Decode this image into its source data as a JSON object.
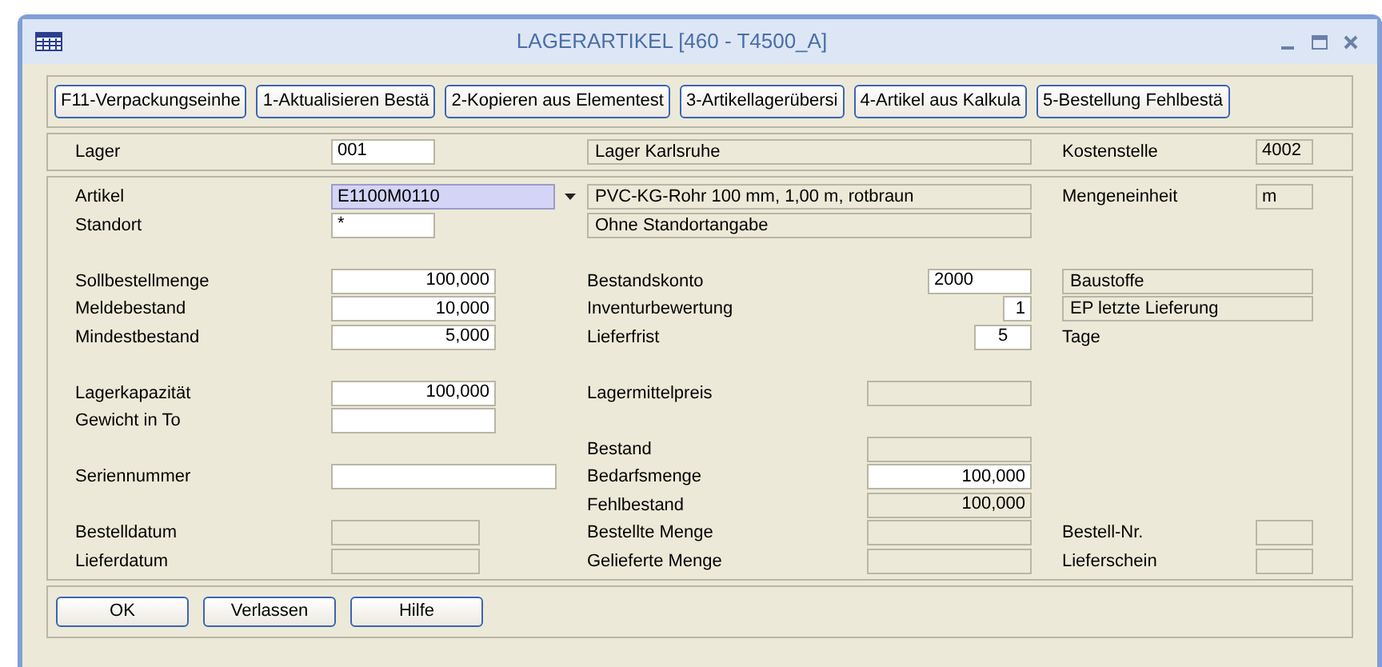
{
  "window": {
    "title": "LAGERARTIKEL  [460 - T4500_A]"
  },
  "toolbar": [
    "F11-Verpackungseinhe",
    "1-Aktualisieren Bestä",
    "2-Kopieren aus Elementest",
    "3-Artikellagerübersi",
    "4-Artikel aus Kalkula",
    "5-Bestellung Fehlbestä"
  ],
  "header_row": {
    "left": {
      "label": "Lager",
      "field": {
        "value": "001",
        "readonly": false,
        "kind": "code"
      }
    },
    "middle": {
      "box": "Lager Karlsruhe"
    },
    "right": {
      "label": "Kostenstelle",
      "field": {
        "value": "4002",
        "readonly": true,
        "kind": "unit"
      }
    }
  },
  "groups": [
    [
      {
        "left": {
          "label": "Artikel",
          "field": {
            "value": "E1100M0110",
            "readonly": false,
            "kind": "combo",
            "focused": true
          }
        },
        "middle": {
          "box": "PVC-KG-Rohr 100 mm, 1,00 m, rotbraun"
        },
        "right": {
          "label": "Mengeneinheit",
          "field": {
            "value": "m",
            "readonly": true,
            "kind": "unit"
          }
        }
      },
      {
        "left": {
          "label": "Standort",
          "field": {
            "value": "*",
            "readonly": false,
            "kind": "code"
          }
        },
        "middle": {
          "box": "Ohne Standortangabe"
        }
      }
    ],
    [
      {
        "left": {
          "label": "Sollbestellmenge",
          "field": {
            "value": "100,000",
            "readonly": false,
            "kind": "quantity"
          }
        },
        "middle": {
          "label": "Bestandskonto",
          "field": {
            "value": "2000",
            "readonly": false,
            "kind": "code"
          }
        },
        "right": {
          "box": "Baustoffe"
        }
      },
      {
        "left": {
          "label": "Meldebestand",
          "field": {
            "value": "10,000",
            "readonly": false,
            "kind": "quantity"
          }
        },
        "middle": {
          "label": "Inventurbewertung",
          "field": {
            "value": "1",
            "readonly": false,
            "kind": "digit"
          }
        },
        "right": {
          "box": "EP letzte Lieferung"
        }
      },
      {
        "left": {
          "label": "Mindestbestand",
          "field": {
            "value": "5,000",
            "readonly": false,
            "kind": "quantity"
          }
        },
        "middle": {
          "label": "Lieferfrist",
          "field": {
            "value": "5",
            "readonly": false,
            "kind": "days"
          }
        },
        "right": {
          "text": "Tage"
        }
      }
    ],
    [
      {
        "left": {
          "label": "Lagerkapazität",
          "field": {
            "value": "100,000",
            "readonly": false,
            "kind": "quantity"
          }
        },
        "middle": {
          "label": "Lagermittelpreis",
          "field": {
            "readonly": true,
            "kind": "quantity"
          }
        }
      },
      {
        "left": {
          "label": "Gewicht in To",
          "field": {
            "readonly": false,
            "kind": "quantity"
          }
        }
      },
      {
        "middle": {
          "label": "Bestand",
          "field": {
            "readonly": true,
            "kind": "quantity"
          }
        }
      },
      {
        "left": {
          "label": "Seriennummer",
          "field": {
            "readonly": false,
            "kind": "serial"
          }
        },
        "middle": {
          "label": "Bedarfsmenge",
          "field": {
            "value": "100,000",
            "readonly": false,
            "kind": "quantity"
          }
        }
      },
      {
        "middle": {
          "label": "Fehlbestand",
          "field": {
            "value": "100,000",
            "readonly": true,
            "kind": "quantity"
          }
        }
      },
      {
        "left": {
          "label": "Bestelldatum",
          "field": {
            "readonly": true,
            "kind": "date"
          }
        },
        "middle": {
          "label": "Bestellte Menge",
          "field": {
            "readonly": true,
            "kind": "quantity"
          }
        },
        "right": {
          "label": "Bestell-Nr.",
          "field": {
            "readonly": true,
            "kind": "unit"
          }
        }
      },
      {
        "left": {
          "label": "Lieferdatum",
          "field": {
            "readonly": true,
            "kind": "date"
          }
        },
        "middle": {
          "label": "Gelieferte Menge",
          "field": {
            "readonly": true,
            "kind": "quantity"
          }
        },
        "right": {
          "label": "Lieferschein",
          "field": {
            "readonly": true,
            "kind": "unit"
          }
        }
      }
    ]
  ],
  "buttons": [
    "OK",
    "Verlassen",
    "Hilfe"
  ]
}
